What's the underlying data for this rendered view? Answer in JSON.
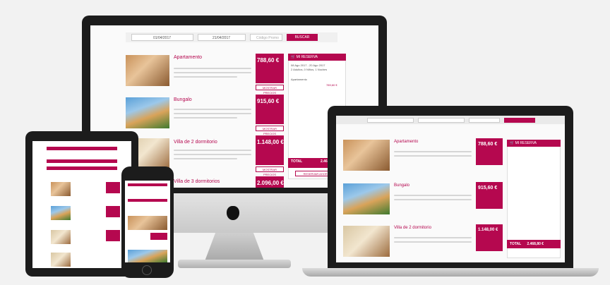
{
  "search": {
    "date_in": "01/04/2017",
    "date_out": "21/04/2017",
    "promo_placeholder": "Código Promo",
    "button": "BUSCAR"
  },
  "listings": [
    {
      "title": "Apartamento",
      "price": "788,60 €",
      "cta": "MOSTRAR PRECIOS"
    },
    {
      "title": "Bungalo",
      "price": "915,60 €",
      "cta": "MOSTRAR PRECIOS"
    },
    {
      "title": "Villa de 2 dormitorio",
      "price": "1.148,00 €",
      "cta": "MOSTRAR PRECIOS"
    },
    {
      "title": "Villa de 3 dormitorios",
      "price": "2.096,00 €",
      "cta": "MOSTRAR PRECIOS"
    }
  ],
  "cart": {
    "title": "MI RESERVA",
    "dates": "08 Ago 2017 - 20 Ago 2017",
    "guests": "2 Adultos, 0 Niños, 1 Noches",
    "item1": "Apartamento",
    "item1_price": "789,60 €",
    "total_label": "TOTAL",
    "total_value": "2.468,80 €",
    "book_button": "RESERVAR AHORA"
  },
  "colors": {
    "brand": "#b5084f",
    "device_dark": "#1c1c1c",
    "silver": "#c9c9c9"
  }
}
